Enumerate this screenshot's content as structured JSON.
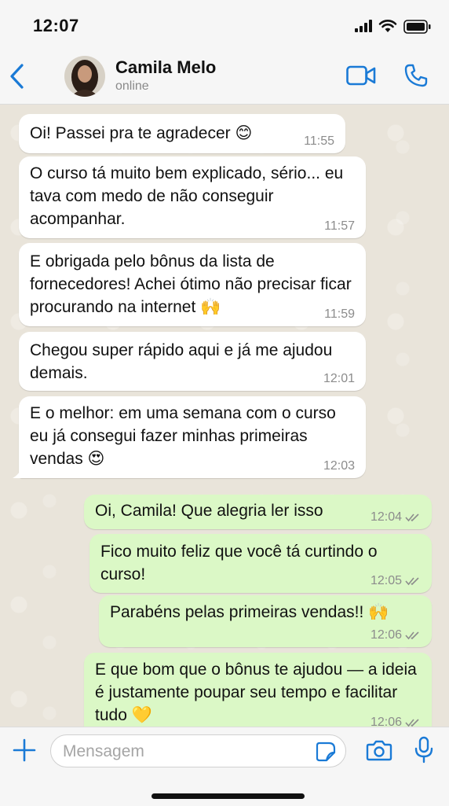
{
  "status": {
    "time": "12:07"
  },
  "header": {
    "contact_name": "Camila Melo",
    "contact_status": "online"
  },
  "colors": {
    "accent": "#1a7ad6",
    "incoming_bubble": "#ffffff",
    "outgoing_bubble": "#dbf8c6",
    "chat_background": "#e9e4da"
  },
  "icons": [
    "back-chevron-icon",
    "video-call-icon",
    "phone-call-icon",
    "plus-icon",
    "sticker-icon",
    "camera-icon",
    "microphone-icon",
    "double-check-icon"
  ],
  "messages": [
    {
      "direction": "in",
      "text": "Oi! Passei pra te agradecer 😊",
      "time": "11:55"
    },
    {
      "direction": "in",
      "text": "O curso tá muito bem explicado, sério... eu tava com medo de não conseguir acompanhar.",
      "time": "11:57"
    },
    {
      "direction": "in",
      "text": "E obrigada pelo bônus da lista de fornecedores! Achei ótimo não precisar ficar procurando na internet 🙌",
      "time": "11:59"
    },
    {
      "direction": "in",
      "text": "Chegou super rápido aqui e já me ajudou demais.",
      "time": "12:01"
    },
    {
      "direction": "in",
      "text": "E o melhor: em uma semana com o curso eu já consegui fazer minhas primeiras vendas 😍",
      "time": "12:03"
    },
    {
      "direction": "out",
      "text": "Oi, Camila! Que alegria ler isso",
      "time": "12:04"
    },
    {
      "direction": "out",
      "text": "Fico muito feliz que você tá curtindo o curso!",
      "time": "12:05"
    },
    {
      "direction": "out",
      "text": "Parabéns pelas primeiras vendas!! 🙌",
      "time": "12:06"
    },
    {
      "direction": "out",
      "text": "E que bom que o bônus te ajudou — a ideia é justamente poupar seu tempo e facilitar tudo 💛",
      "time": "12:06"
    }
  ],
  "composer": {
    "placeholder": "Mensagem"
  }
}
